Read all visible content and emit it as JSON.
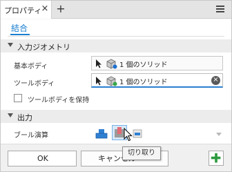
{
  "window": {
    "tab_label": "プロパティ",
    "close_glyph": "×",
    "add_glyph": "+"
  },
  "content": {
    "link_tab": "結合",
    "sections": {
      "input_geometry": {
        "title": "入力ジオメトリ"
      },
      "output": {
        "title": "出力"
      }
    },
    "base_body": {
      "label": "基本ボディ",
      "value": "1 個のソリッド"
    },
    "tool_body": {
      "label": "ツールボディ",
      "value": "1 個のソリッド",
      "clear_glyph": "×"
    },
    "keep_tool_body": {
      "label": "ツールボディを保持",
      "checked": false
    },
    "boolean_op": {
      "label": "ブール演算",
      "options": [
        "join",
        "cut",
        "intersect"
      ],
      "selected": "cut"
    },
    "tooltip": "切り取り"
  },
  "footer": {
    "ok_label": "OK",
    "cancel_label": "キャンセル"
  },
  "colors": {
    "accent": "#1a7fd0",
    "selected_op_bg": "#d6e8f8",
    "plus_green": "#2c9a3e"
  },
  "icons": {
    "menu": "hamburger-menu-icon",
    "cursor": "arrow-cursor-icon",
    "body": "solid-body-icon",
    "join": "boolean-join-icon",
    "cut": "boolean-cut-icon",
    "intersect": "boolean-intersect-icon",
    "plus": "green-plus-icon"
  }
}
